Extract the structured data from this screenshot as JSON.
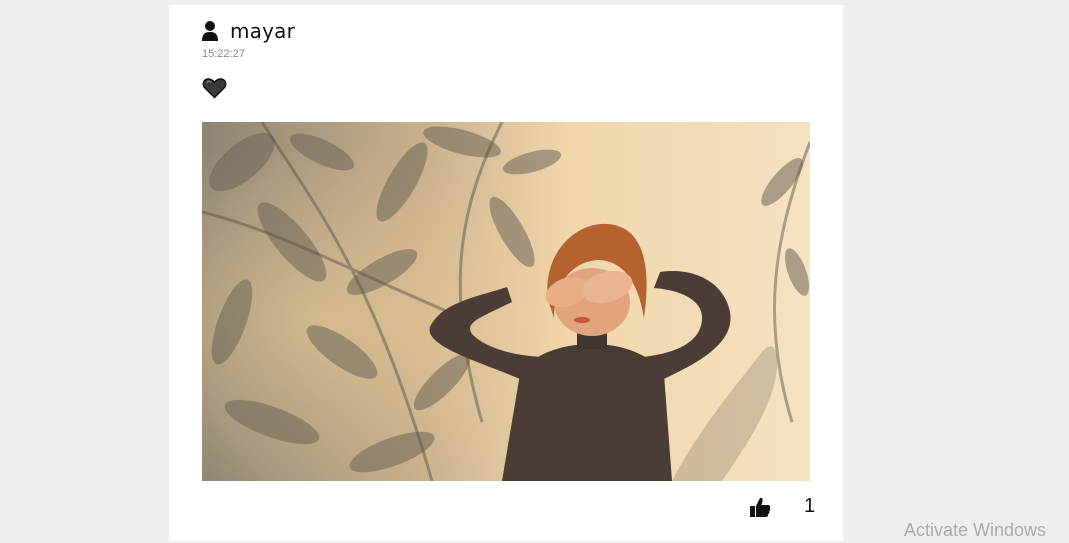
{
  "post": {
    "username": "mayar",
    "time": "15:22:27",
    "likes": "1",
    "icons": {
      "user": "user-icon",
      "favorite": "heart-icon",
      "like": "thumbs-up-icon"
    },
    "photo_description": "woman shading eyes against sunlit wall with leaf shadows"
  },
  "watermark": "Activate Windows",
  "colors": {
    "page_bg": "#edeef0",
    "card_bg": "#ffffff",
    "wall": "#f1d9b1",
    "sweater": "#4a3c35"
  }
}
